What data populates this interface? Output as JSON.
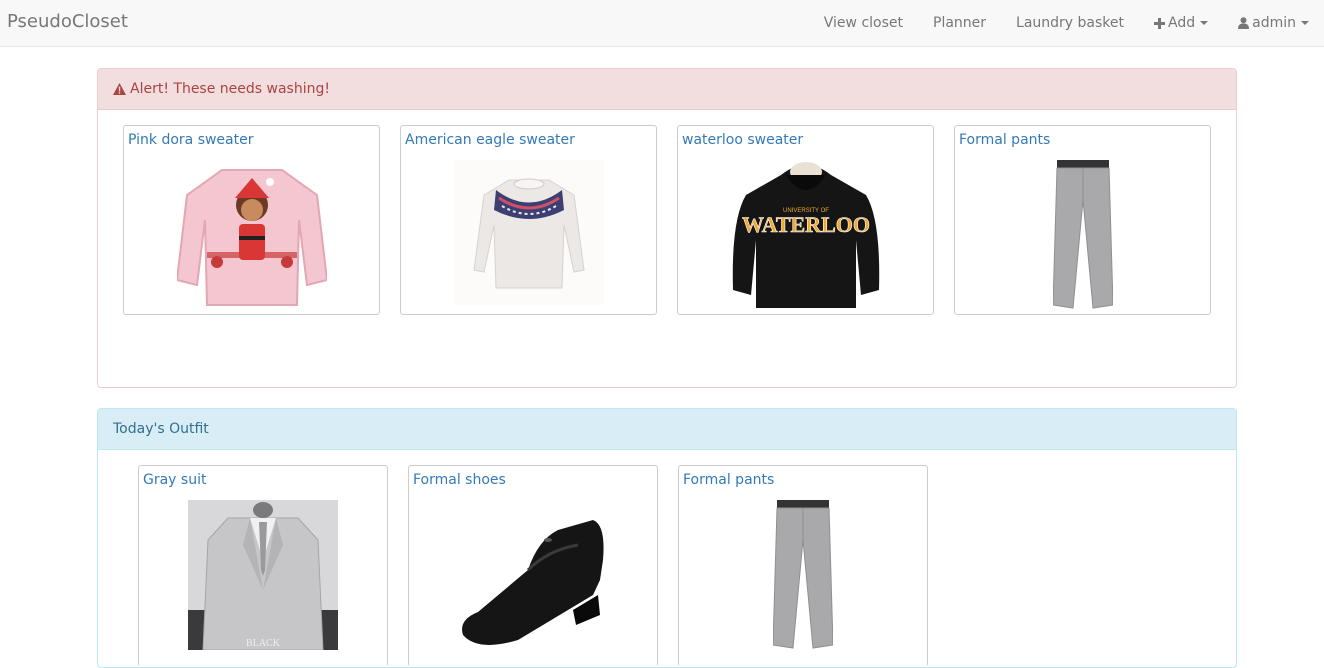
{
  "navbar": {
    "brand": "PseudoCloset",
    "items": [
      {
        "label": "View closet"
      },
      {
        "label": "Planner"
      },
      {
        "label": "Laundry basket"
      },
      {
        "label": "Add",
        "icon": "plus-icon",
        "dropdown": true
      },
      {
        "label": "admin",
        "icon": "user-icon",
        "dropdown": true
      }
    ]
  },
  "alert_panel": {
    "heading": "Alert! These needs washing!",
    "icon": "warning-icon",
    "color": "#a94442",
    "items": [
      {
        "title": "Pink dora sweater"
      },
      {
        "title": "American eagle sweater"
      },
      {
        "title": "waterloo sweater"
      },
      {
        "title": "Formal pants"
      }
    ],
    "carousel_pages": 3,
    "active_page": 1
  },
  "outfit_panel": {
    "heading": "Today's Outfit",
    "color": "#31708f",
    "items": [
      {
        "title": "Gray suit",
        "caption": "BLACK"
      },
      {
        "title": "Formal shoes"
      },
      {
        "title": "Formal pants"
      }
    ]
  }
}
